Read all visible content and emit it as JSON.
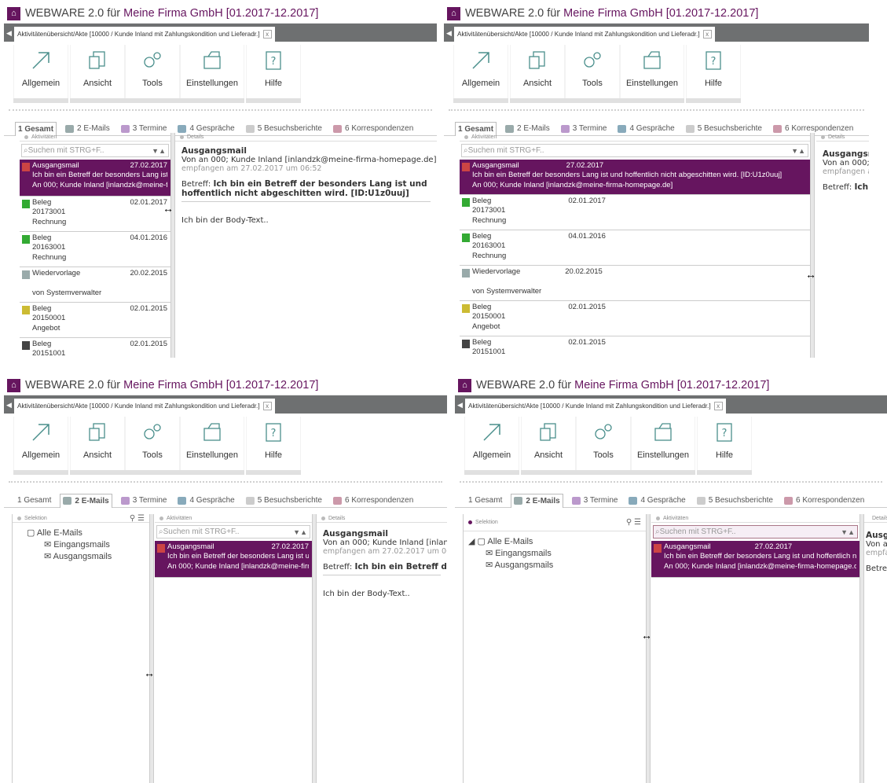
{
  "app": {
    "title_prefix": "WEBWARE 2.0 für",
    "firm": "Meine Firma GmbH",
    "period": "[01.2017-12.2017]",
    "home_glyph": "⌂",
    "doc_tab": "Aktivitätenübersicht/Akte [10000 / Kunde Inland mit Zahlungskondition und Lieferadr.]",
    "accent": "#66155f"
  },
  "ribbon": {
    "allgemein": "Allgemein",
    "ansicht": "Ansicht",
    "tools": "Tools",
    "einstellungen": "Einstellungen",
    "hilfe": "Hilfe"
  },
  "filter_tabs": {
    "gesamt": "1 Gesamt",
    "emails": "2 E-Mails",
    "termine": "3 Termine",
    "gespraeche": "4 Gespräche",
    "besuchsberichte": "5 Besuchsberichte",
    "korrespondenzen": "6 Korrespondenzen"
  },
  "columns": {
    "aktivitaeten": "Aktivitäten",
    "details": "Details",
    "selektion": "Selektion"
  },
  "search": {
    "placeholder": "Suchen mit STRG+F..",
    "sort": "▼▲"
  },
  "items": [
    {
      "type": "Ausgangsmail",
      "date": "27.02.2017",
      "line2": "Ich bin ein Betreff der besonders Lang ist und hoffentlich nicht abgeschitten wird. [ID:U1z0uuj]",
      "line3": "An 000; Kunde Inland [inlandzk@meine-firma-homepage.de]"
    },
    {
      "type": "Beleg",
      "date": "02.01.2017",
      "line2": "20173001",
      "line3": "Rechnung"
    },
    {
      "type": "Beleg",
      "date": "04.01.2016",
      "line2": "20163001",
      "line3": "Rechnung"
    },
    {
      "type": "Wiedervorlage",
      "date": "20.02.2015",
      "line2": "",
      "line3": "von Systemverwalter"
    },
    {
      "type": "Beleg",
      "date": "02.01.2015",
      "line2": "20150001",
      "line3": "Angebot"
    },
    {
      "type": "Beleg",
      "date": "02.01.2015",
      "line2": "20151001",
      "line3": ""
    }
  ],
  "details": {
    "subject": "Ausgangsmail",
    "from_1": "Von an 000; Kunde Inland [inlandzk@meine-firma-homepage.de]",
    "from_2": "Von an 000; Kunde Inland [inlandzk@meine-firma-homepage.de]",
    "received_1": "empfangen am 27.02.2017 um 06:52",
    "received_2": "empfangen am 27.02.2017 um 06:52",
    "betreff_label": "Betreff:",
    "betreff_text": "Ich bin ein Betreff der besonders Lang ist und hoffentlich nicht abgeschitten wird. [ID:U1z0uuj]",
    "body": "Ich bin der Body-Text.."
  },
  "tree": {
    "root": "Alle E-Mails",
    "in": "Eingangsmails",
    "out": "Ausgangsmails"
  }
}
